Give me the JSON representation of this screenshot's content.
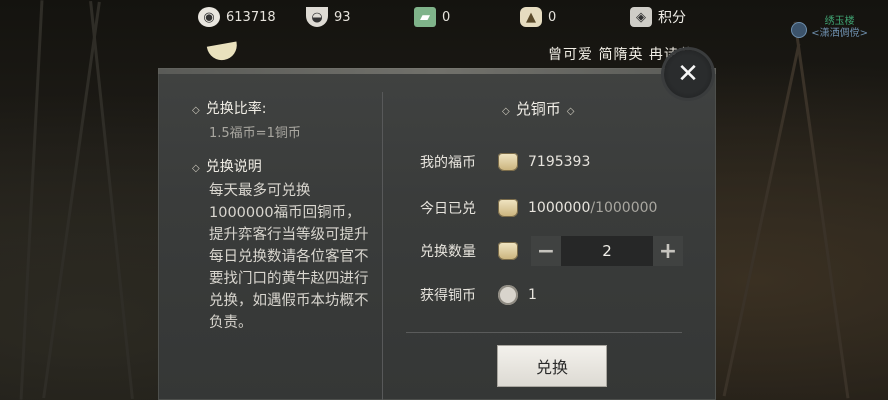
{
  "topbar": {
    "resources": [
      {
        "icon": "coin-reel-icon",
        "value": "613718"
      },
      {
        "icon": "rice-bowl-icon",
        "value": "93"
      },
      {
        "icon": "green-ticket-icon",
        "value": "0"
      },
      {
        "icon": "money-bag-icon",
        "value": "0"
      }
    ],
    "score_label": "积分"
  },
  "guest": {
    "name": "绣玉楼",
    "subtitle": "<潇洒倜傥>"
  },
  "broadcast": {
    "names": "曾可爱 简隋英 冉诗菲"
  },
  "panel": {
    "left": {
      "rate_title": "兑换比率:",
      "rate_value": "1.5福币=1铜币",
      "desc_title": "兑换说明",
      "desc_text": "每天最多可兑换1000000福币回铜币，提升弈客行当等级可提升每日兑换数请各位客官不要找门口的黄牛赵四进行兑换，如遇假币本坊概不负责。"
    },
    "right": {
      "title": "兑铜币",
      "my_fubi_label": "我的福币",
      "my_fubi_value": "7195393",
      "today_label": "今日已兑",
      "today_value": "1000000",
      "today_max": "/1000000",
      "qty_label": "兑换数量",
      "qty_minus": "−",
      "qty_value": "2",
      "qty_plus": "+",
      "get_label": "获得铜币",
      "get_value": "1",
      "exchange_button": "兑换"
    },
    "close_symbol": "✕"
  }
}
